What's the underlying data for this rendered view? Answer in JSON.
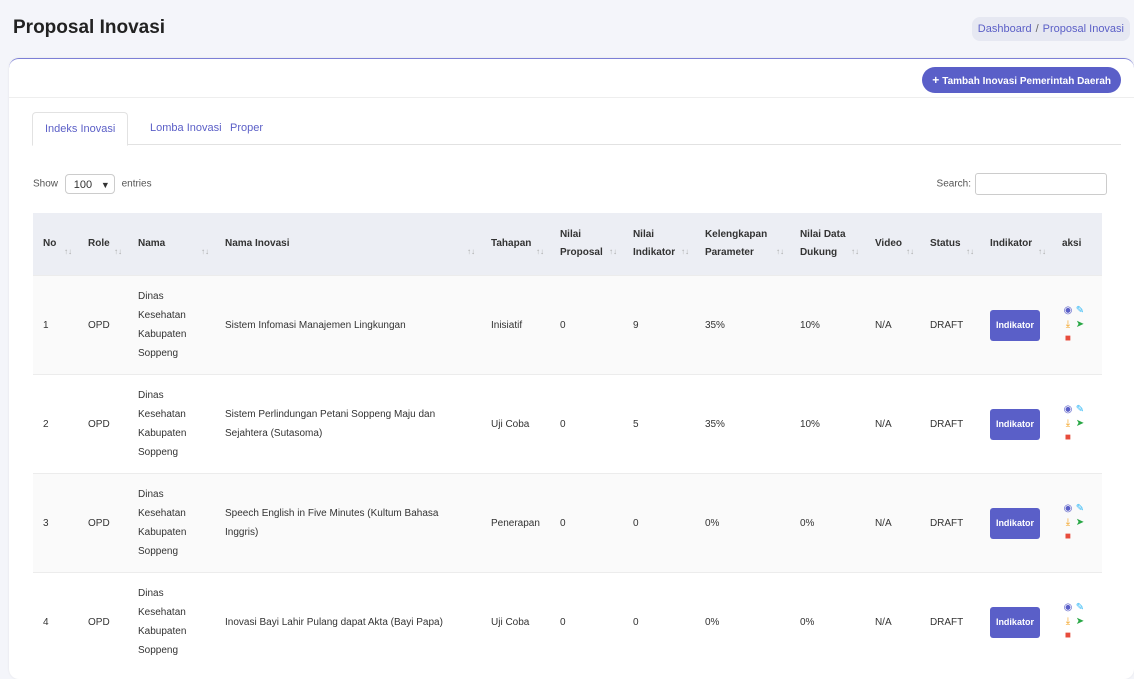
{
  "header": {
    "title": "Proposal Inovasi",
    "breadcrumb": {
      "home": "Dashboard",
      "sep": "/",
      "current": "Proposal Inovasi"
    }
  },
  "toolbar": {
    "add_label": "Tambah Inovasi Pemerintah Daerah"
  },
  "tabs": [
    {
      "label": "Indeks Inovasi",
      "active": true
    },
    {
      "label": "Lomba Inovasi",
      "active": false
    },
    {
      "label": "Proper",
      "active": false
    }
  ],
  "table_controls": {
    "show_label": "Show",
    "entries_value": "100",
    "entries_label": "entries",
    "search_label": "Search:"
  },
  "table": {
    "columns": [
      "No",
      "Role",
      "Nama",
      "Nama Inovasi",
      "Tahapan",
      "Nilai Proposal",
      "Nilai Indikator",
      "Kelengkapan Parameter",
      "Nilai Data Dukung",
      "Video",
      "Status",
      "Indikator",
      "aksi"
    ],
    "rows": [
      {
        "no": "1",
        "role": "OPD",
        "nama": "Dinas Kesehatan Kabupaten Soppeng",
        "nama_inovasi": "Sistem Infomasi Manajemen Lingkungan",
        "tahapan": "Inisiatif",
        "nilai_proposal": "0",
        "nilai_indikator": "9",
        "kelengkapan": "35%",
        "nilai_data": "10%",
        "video": "N/A",
        "status": "DRAFT",
        "indikator_btn": "Indikator"
      },
      {
        "no": "2",
        "role": "OPD",
        "nama": "Dinas Kesehatan Kabupaten Soppeng",
        "nama_inovasi": "Sistem Perlindungan Petani Soppeng Maju dan Sejahtera (Sutasoma)",
        "tahapan": "Uji Coba",
        "nilai_proposal": "0",
        "nilai_indikator": "5",
        "kelengkapan": "35%",
        "nilai_data": "10%",
        "video": "N/A",
        "status": "DRAFT",
        "indikator_btn": "Indikator"
      },
      {
        "no": "3",
        "role": "OPD",
        "nama": "Dinas Kesehatan Kabupaten Soppeng",
        "nama_inovasi": "Speech English in Five Minutes (Kultum Bahasa Inggris)",
        "tahapan": "Penerapan",
        "nilai_proposal": "0",
        "nilai_indikator": "0",
        "kelengkapan": "0%",
        "nilai_data": "0%",
        "video": "N/A",
        "status": "DRAFT",
        "indikator_btn": "Indikator"
      },
      {
        "no": "4",
        "role": "OPD",
        "nama": "Dinas Kesehatan Kabupaten Soppeng",
        "nama_inovasi": "Inovasi Bayi Lahir Pulang dapat Akta (Bayi Papa)",
        "tahapan": "Uji Coba",
        "nilai_proposal": "0",
        "nilai_indikator": "0",
        "kelengkapan": "0%",
        "nilai_data": "0%",
        "video": "N/A",
        "status": "DRAFT",
        "indikator_btn": "Indikator"
      }
    ]
  },
  "icons": [
    "eye-icon",
    "pencil-icon",
    "download-icon",
    "send-icon",
    "trash-icon"
  ],
  "colors": {
    "accent": "#5a5fc8",
    "header_bg": "#eceef4"
  }
}
